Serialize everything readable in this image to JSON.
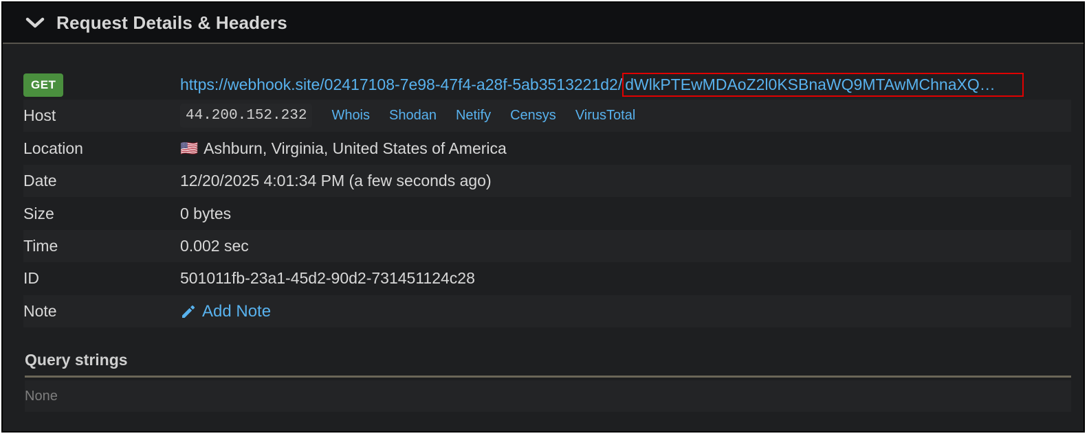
{
  "header": {
    "title": "Request Details & Headers"
  },
  "request": {
    "method": "GET",
    "url_base": "https://webhook.site/02417108-7e98-47f4-a28f-5ab3513221d2/",
    "url_tail": "dWlkPTEwMDAoZ2l0KSBnaWQ9MTAwMChnaXQ…"
  },
  "details": {
    "host": {
      "label": "Host",
      "ip": "44.200.152.232"
    },
    "lookups": [
      "Whois",
      "Shodan",
      "Netify",
      "Censys",
      "VirusTotal"
    ],
    "location": {
      "label": "Location",
      "flag": "🇺🇸",
      "value": "Ashburn, Virginia, United States of America"
    },
    "date": {
      "label": "Date",
      "value": "12/20/2025 4:01:34 PM (a few seconds ago)"
    },
    "size": {
      "label": "Size",
      "value": "0 bytes"
    },
    "time": {
      "label": "Time",
      "value": "0.002 sec"
    },
    "id": {
      "label": "ID",
      "value": "501011fb-23a1-45d2-90d2-731451124c28"
    },
    "note": {
      "label": "Note",
      "link": "Add Note"
    }
  },
  "query_strings": {
    "title": "Query strings",
    "empty_text": "None"
  },
  "colors": {
    "link": "#58b2ee",
    "badge_get": "#4a8f3e",
    "highlight": "#e00000"
  }
}
